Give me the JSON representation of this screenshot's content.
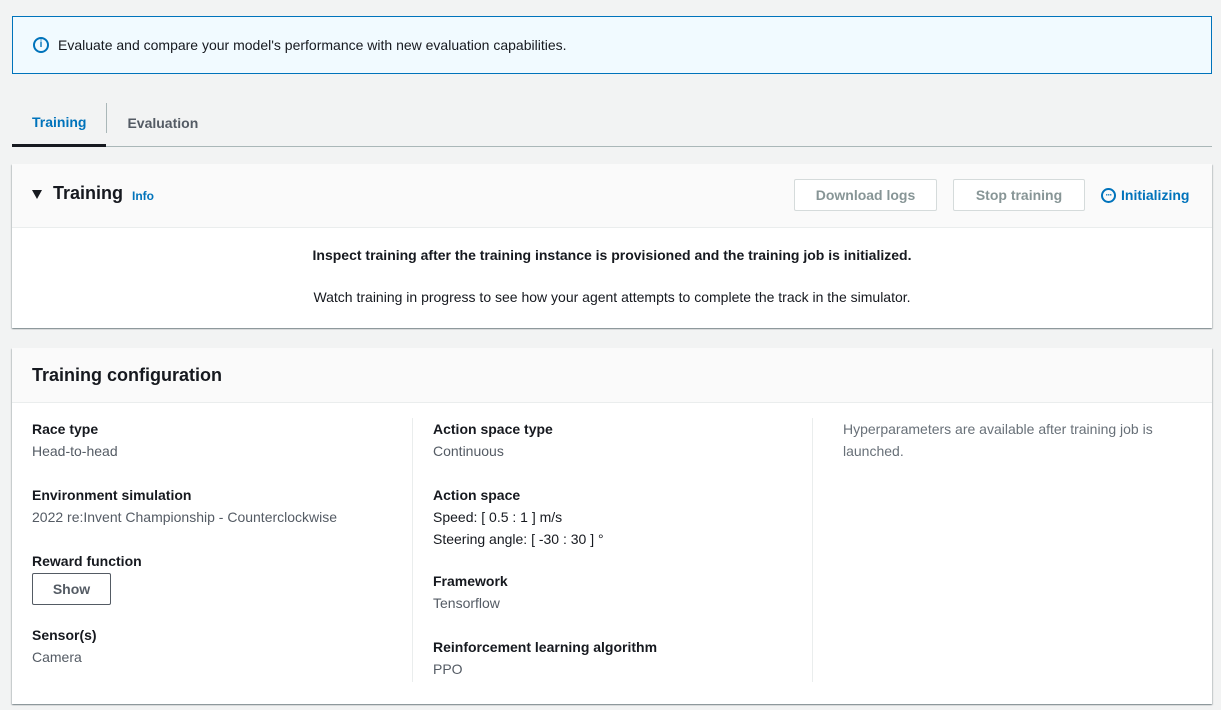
{
  "flash": {
    "icon": "info-circle-icon",
    "message": "Evaluate and compare your model's performance with new evaluation capabilities."
  },
  "tabs": [
    {
      "label": "Training",
      "active": true
    },
    {
      "label": "Evaluation",
      "active": false
    }
  ],
  "training_panel": {
    "title": "Training",
    "info_link": "Info",
    "download_logs_label": "Download logs",
    "stop_training_label": "Stop training",
    "status": "Initializing",
    "message_bold": "Inspect training after the training instance is provisioned and the training job is initialized.",
    "message": "Watch training in progress to see how your agent attempts to complete the track in the simulator."
  },
  "config_panel": {
    "title": "Training configuration",
    "race_type": {
      "label": "Race type",
      "value": "Head-to-head"
    },
    "environment": {
      "label": "Environment simulation",
      "value": "2022 re:Invent Championship - Counterclockwise"
    },
    "reward_function": {
      "label": "Reward function",
      "button": "Show"
    },
    "sensors": {
      "label": "Sensor(s)",
      "value": "Camera"
    },
    "action_space_type": {
      "label": "Action space type",
      "value": "Continuous"
    },
    "action_space": {
      "label": "Action space",
      "speed": "Speed: [ 0.5 : 1 ] m/s",
      "steering": "Steering angle: [ -30 : 30 ] °"
    },
    "framework": {
      "label": "Framework",
      "value": "Tensorflow"
    },
    "algorithm": {
      "label": "Reinforcement learning algorithm",
      "value": "PPO"
    },
    "hyperparameters_note": "Hyperparameters are available after training job is launched."
  },
  "colors": {
    "accent": "#0073bb",
    "background": "#f2f3f3",
    "flash_background": "#f1faff"
  }
}
